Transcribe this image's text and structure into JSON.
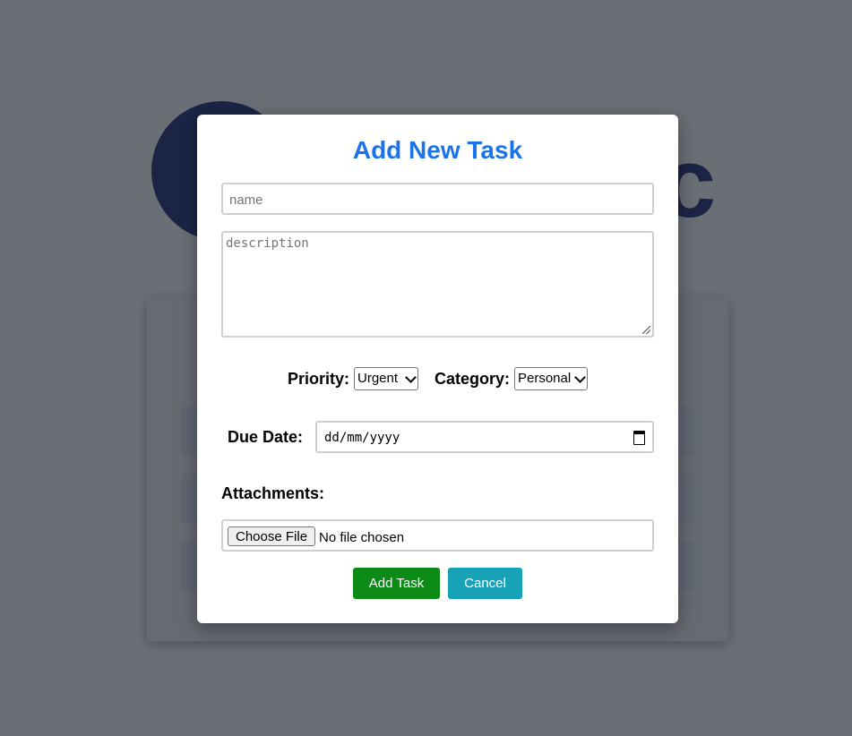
{
  "background": {
    "logo_letter": "c"
  },
  "modal": {
    "title": "Add New Task",
    "name_placeholder": "name",
    "description_placeholder": "description",
    "priority_label": "Priority:",
    "priority_selected": "Urgent",
    "category_label": "Category:",
    "category_selected": "Personal",
    "due_date_label": "Due Date:",
    "due_date_value": "dd/mm/yyyy",
    "attachments_label": "Attachments:",
    "file_button_label": "Choose File",
    "file_status": "No file chosen",
    "add_button_label": "Add Task",
    "cancel_button_label": "Cancel"
  },
  "colors": {
    "title": "#1a73e8",
    "add_button": "#0b8a15",
    "cancel_button": "#17a2b8",
    "logo_dark": "#0a1a6b"
  },
  "icons": [
    "calendar-icon",
    "chevron-down-icon",
    "resize-grip-icon"
  ]
}
